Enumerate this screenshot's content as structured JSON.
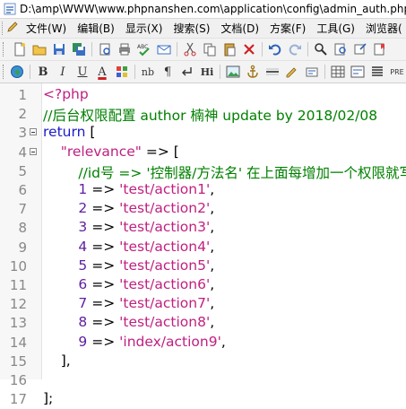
{
  "window": {
    "title": "D:\\amp\\WWW\\www.phpnanshen.com\\application\\config\\admin_auth.php"
  },
  "menu": {
    "items": [
      "文件(W)",
      "编辑(B)",
      "显示(X)",
      "搜索(S)",
      "文档(D)",
      "方案(F)",
      "工具(G)",
      "浏览器("
    ]
  },
  "toolbar2": {
    "bold": "B",
    "italic": "I",
    "underline": "U",
    "fontcolor": "A",
    "nb": "nb",
    "para": "¶",
    "hi": "Hi",
    "pre": "PRE"
  },
  "editor": {
    "lines": [
      {
        "num": "1",
        "fold": false,
        "tokens": [
          {
            "t": "<?php",
            "c": "s"
          }
        ]
      },
      {
        "num": "2",
        "fold": false,
        "tokens": [
          {
            "t": "//后台权限配置 author 楠神 update by 2018/02/08",
            "c": "c"
          }
        ]
      },
      {
        "num": "3",
        "fold": true,
        "tokens": [
          {
            "t": "return",
            "c": "k"
          },
          {
            "t": " [",
            "c": "p"
          }
        ]
      },
      {
        "num": "4",
        "fold": true,
        "tokens": [
          {
            "t": "    \"relevance\"",
            "c": "s"
          },
          {
            "t": " => [",
            "c": "p"
          }
        ]
      },
      {
        "num": "5",
        "fold": false,
        "tokens": [
          {
            "t": "        //id号 => '控制器/方法名' 在上面每增加一个权限就写",
            "c": "c"
          }
        ]
      },
      {
        "num": "6",
        "fold": false,
        "tokens": [
          {
            "t": "        1",
            "c": "n"
          },
          {
            "t": " => ",
            "c": "p"
          },
          {
            "t": "'test/action1'",
            "c": "s"
          },
          {
            "t": ",",
            "c": "p"
          }
        ]
      },
      {
        "num": "7",
        "fold": false,
        "tokens": [
          {
            "t": "        2",
            "c": "n"
          },
          {
            "t": " => ",
            "c": "p"
          },
          {
            "t": "'test/action2'",
            "c": "s"
          },
          {
            "t": ",",
            "c": "p"
          }
        ]
      },
      {
        "num": "8",
        "fold": false,
        "tokens": [
          {
            "t": "        3",
            "c": "n"
          },
          {
            "t": " => ",
            "c": "p"
          },
          {
            "t": "'test/action3'",
            "c": "s"
          },
          {
            "t": ",",
            "c": "p"
          }
        ]
      },
      {
        "num": "9",
        "fold": false,
        "tokens": [
          {
            "t": "        4",
            "c": "n"
          },
          {
            "t": " => ",
            "c": "p"
          },
          {
            "t": "'test/action4'",
            "c": "s"
          },
          {
            "t": ",",
            "c": "p"
          }
        ]
      },
      {
        "num": "10",
        "fold": false,
        "tokens": [
          {
            "t": "        5",
            "c": "n"
          },
          {
            "t": " => ",
            "c": "p"
          },
          {
            "t": "'test/action5'",
            "c": "s"
          },
          {
            "t": ",",
            "c": "p"
          }
        ]
      },
      {
        "num": "11",
        "fold": false,
        "tokens": [
          {
            "t": "        6",
            "c": "n"
          },
          {
            "t": " => ",
            "c": "p"
          },
          {
            "t": "'test/action6'",
            "c": "s"
          },
          {
            "t": ",",
            "c": "p"
          }
        ]
      },
      {
        "num": "12",
        "fold": false,
        "tokens": [
          {
            "t": "        7",
            "c": "n"
          },
          {
            "t": " => ",
            "c": "p"
          },
          {
            "t": "'test/action7'",
            "c": "s"
          },
          {
            "t": ",",
            "c": "p"
          }
        ]
      },
      {
        "num": "13",
        "fold": false,
        "tokens": [
          {
            "t": "        8",
            "c": "n"
          },
          {
            "t": " => ",
            "c": "p"
          },
          {
            "t": "'test/action8'",
            "c": "s"
          },
          {
            "t": ",",
            "c": "p"
          }
        ]
      },
      {
        "num": "14",
        "fold": false,
        "tokens": [
          {
            "t": "        9",
            "c": "n"
          },
          {
            "t": " => ",
            "c": "p"
          },
          {
            "t": "'index/action9'",
            "c": "s"
          },
          {
            "t": ",",
            "c": "p"
          }
        ]
      },
      {
        "num": "15",
        "fold": false,
        "tokens": [
          {
            "t": "    ],",
            "c": "p"
          }
        ]
      },
      {
        "num": "16",
        "fold": false,
        "tokens": []
      },
      {
        "num": "17",
        "fold": false,
        "tokens": [
          {
            "t": "];",
            "c": "p"
          }
        ]
      }
    ]
  },
  "colors": {
    "keyword": "#1a1acc",
    "comment": "#008000",
    "string": "#c02080",
    "number": "#6020a0"
  }
}
